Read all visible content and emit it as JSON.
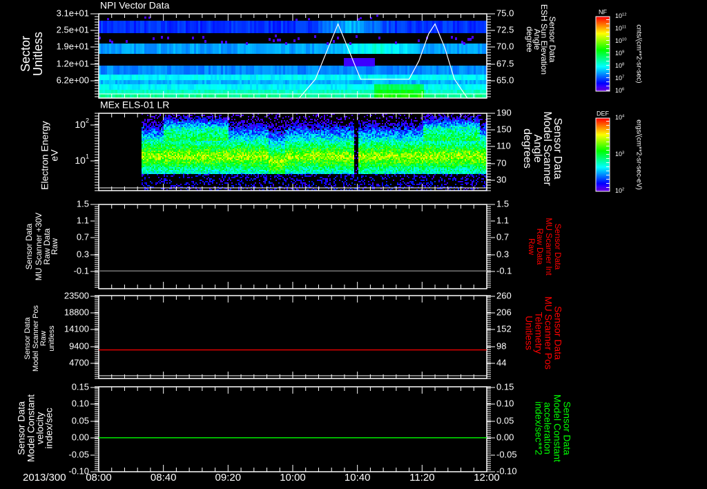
{
  "x_axis": {
    "date_label": "2013/300",
    "ticks": [
      "08:00",
      "08:40",
      "09:20",
      "10:00",
      "10:40",
      "11:20",
      "12:00"
    ]
  },
  "colors": {
    "background": "#000000",
    "axis": "#ffffff",
    "red": "#ff0000",
    "green": "#00ff00",
    "gray": "#808080"
  },
  "chart_data": [
    {
      "type": "heatmap",
      "title": "NPI Vector Data",
      "ylabel": [
        "Sector",
        "Unitless"
      ],
      "yticks": [
        "3.1e+01",
        "2.5e+01",
        "1.9e+01",
        "1.2e+01",
        "6.2e+00"
      ],
      "ylim": [
        0,
        31
      ],
      "y2label": [
        "Sensor Data",
        "ESH Sun Elevation",
        "Angle",
        "degree"
      ],
      "y2ticks": [
        "75.0",
        "72.5",
        "70.0",
        "67.5",
        "65.0"
      ],
      "y2lim": [
        62.5,
        75.0
      ],
      "colorbar": {
        "label": "NF",
        "ticks": [
          "10^12",
          "10^11",
          "10^10",
          "10^9",
          "10^8",
          "10^7",
          "10^6"
        ],
        "units": "cnts/(cm**2-sr-sec)"
      },
      "overlay_series": {
        "color": "#ffffff",
        "x": [
          "08:00",
          "10:04",
          "10:14",
          "10:22",
          "10:28",
          "10:34",
          "10:42",
          "11:12",
          "11:18",
          "11:24",
          "11:28",
          "11:34",
          "11:40",
          "11:48",
          "12:00"
        ],
        "y": [
          62.5,
          62.5,
          65.3,
          70,
          73.5,
          70,
          65.3,
          65.3,
          68,
          72,
          73.5,
          70,
          65.3,
          62.5,
          62.5
        ]
      }
    },
    {
      "type": "heatmap",
      "title": "MEx ELS-01 LR",
      "ylabel": [
        "Electron Energy",
        "eV"
      ],
      "yticks": [
        "10^2",
        "10^1"
      ],
      "ylim": [
        1.5,
        213
      ],
      "yscale": "log",
      "y2label": [
        "Sensor Data",
        "Model Scanner",
        "Angle",
        "degrees"
      ],
      "y2ticks": [
        "190",
        "150",
        "110",
        "70",
        "30"
      ],
      "y2lim": [
        -5,
        190
      ],
      "colorbar": {
        "label": "DEF",
        "ticks": [
          "10^4",
          "10^3",
          "10^2"
        ],
        "units": "ergs/(cm**2-sr-sec-eV)"
      },
      "data_start": "08:25"
    },
    {
      "type": "line",
      "ylabel": [
        "Sensor Data",
        "MU Scanner +30V",
        "Raw Data",
        "Raw"
      ],
      "yticks": [
        "1.5",
        "1.1",
        "0.7",
        "0.3",
        "-0.1"
      ],
      "ylim": [
        -0.4,
        1.5
      ],
      "y2label": [
        "Sensor Data",
        "MU Scanner Int",
        "Raw Data",
        "Raw"
      ],
      "y2ticks": [
        "1.5",
        "1.1",
        "0.7",
        "0.3",
        "-0.1"
      ],
      "y2lim": [
        -0.4,
        1.5
      ],
      "series": [
        {
          "color": "#808080",
          "x": [
            "08:00",
            "12:00"
          ],
          "y": [
            0.0,
            0.0
          ]
        }
      ]
    },
    {
      "type": "line",
      "ylabel": [
        "Sensor Data",
        "Model Scanner Pos",
        "Raw",
        "unitless"
      ],
      "yticks": [
        "23500",
        "18800",
        "14100",
        "9400",
        "4700"
      ],
      "ylim": [
        0,
        23500
      ],
      "y2label": [
        "Sensor Data",
        "MU Scanner Pos",
        "Telemetry",
        "Unitless"
      ],
      "y2ticks": [
        "260",
        "206",
        "152",
        "98",
        "44"
      ],
      "y2lim": [
        -10,
        260
      ],
      "series": [
        {
          "color": "#ff0000",
          "x": [
            "08:00",
            "12:00"
          ],
          "y": [
            8100,
            8100
          ]
        }
      ]
    },
    {
      "type": "line",
      "ylabel": [
        "Sensor Data",
        "Model Constant",
        "velocity",
        "index/sec"
      ],
      "yticks": [
        "0.15",
        "0.10",
        "0.05",
        "0.00",
        "-0.05",
        "-0.10"
      ],
      "ylim": [
        -0.1,
        0.15
      ],
      "y2label": [
        "Sensor Data",
        "Model Constant",
        "acceleration",
        "index/sec**2"
      ],
      "y2ticks": [
        "0.15",
        "0.10",
        "0.05",
        "0.00",
        "-0.05",
        "-0.10"
      ],
      "y2lim": [
        -0.1,
        0.15
      ],
      "series": [
        {
          "color": "#00ff00",
          "x": [
            "08:00",
            "12:00"
          ],
          "y": [
            0.0,
            0.0
          ]
        }
      ]
    }
  ]
}
